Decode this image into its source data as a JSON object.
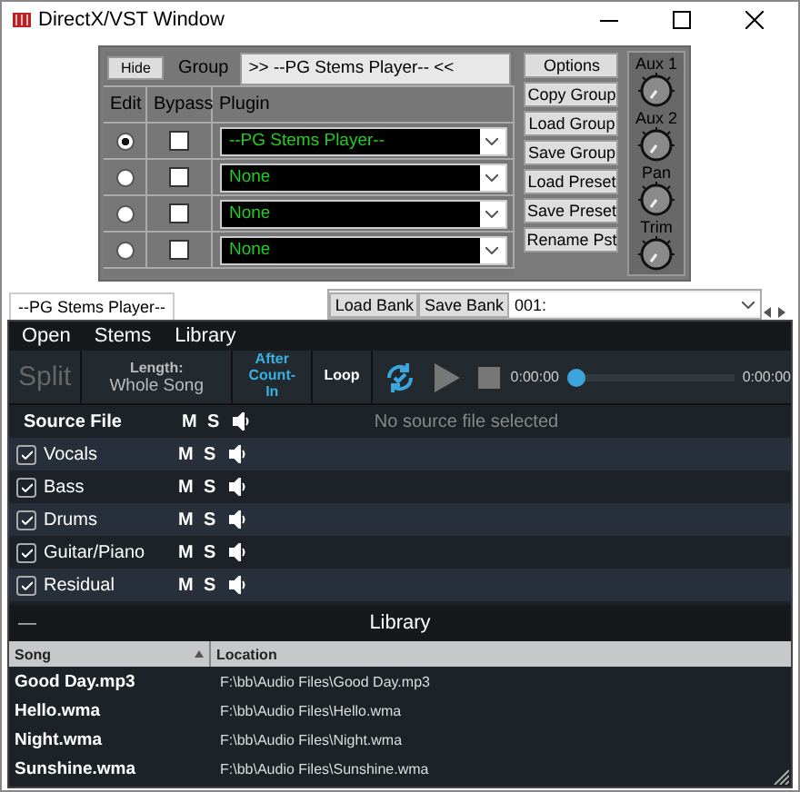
{
  "window": {
    "title": "DirectX/VST Window"
  },
  "rack": {
    "hide_button": "Hide",
    "group_label": "Group",
    "group_value": ">> --PG Stems Player-- <<",
    "columns": [
      "Edit",
      "Bypass",
      "Plugin"
    ],
    "slots": [
      {
        "selected": true,
        "bypass": false,
        "plugin": "--PG Stems Player--"
      },
      {
        "selected": false,
        "bypass": false,
        "plugin": "None"
      },
      {
        "selected": false,
        "bypass": false,
        "plugin": "None"
      },
      {
        "selected": false,
        "bypass": false,
        "plugin": "None"
      }
    ],
    "buttons": [
      "Options",
      "Copy Group",
      "Load Group",
      "Save Group",
      "Load Preset",
      "Save Preset",
      "Rename Pst"
    ],
    "knobs": [
      "Aux 1",
      "Aux 2",
      "Pan",
      "Trim"
    ]
  },
  "plugin_tab": {
    "label": "--PG Stems Player--",
    "bank_buttons": [
      "Load Bank",
      "Save Bank"
    ],
    "preset": "001:"
  },
  "stems_player": {
    "menu": [
      "Open",
      "Stems",
      "Library"
    ],
    "toolbar": {
      "split": {
        "label": "Split",
        "disabled": true
      },
      "length_label": "Length:",
      "length_value": "Whole Song",
      "toggles": [
        {
          "label": "After Count-In",
          "selected": true
        },
        {
          "label": "Loop",
          "selected": false
        }
      ],
      "time_start": "0:00:00",
      "time_end": "0:00:00",
      "position": {
        "level": 0
      }
    },
    "source_label": "Source File",
    "mute": "M",
    "solo": "S",
    "source_status": "No source file selected",
    "stems": [
      {
        "name": "Vocals",
        "checked": true,
        "mute": "M",
        "solo": "S"
      },
      {
        "name": "Bass",
        "checked": true,
        "mute": "M",
        "solo": "S"
      },
      {
        "name": "Drums",
        "checked": true,
        "mute": "M",
        "solo": "S"
      },
      {
        "name": "Guitar/Piano",
        "checked": true,
        "mute": "M",
        "solo": "S"
      },
      {
        "name": "Residual",
        "checked": true,
        "mute": "M",
        "solo": "S"
      }
    ],
    "library": {
      "collapse": "—",
      "title": "Library",
      "columns": [
        {
          "label": "Song",
          "sorted": true
        },
        {
          "label": "Location",
          "sorted": false
        }
      ],
      "rows": [
        {
          "song": "Good Day.mp3",
          "location": "F:\\bb\\Audio Files\\Good Day.mp3"
        },
        {
          "song": "Hello.wma",
          "location": "F:\\bb\\Audio Files\\Hello.wma"
        },
        {
          "song": "Night.wma",
          "location": "F:\\bb\\Audio Files\\Night.wma"
        },
        {
          "song": "Sunshine.wma",
          "location": "F:\\bb\\Audio Files\\Sunshine.wma"
        }
      ]
    }
  }
}
